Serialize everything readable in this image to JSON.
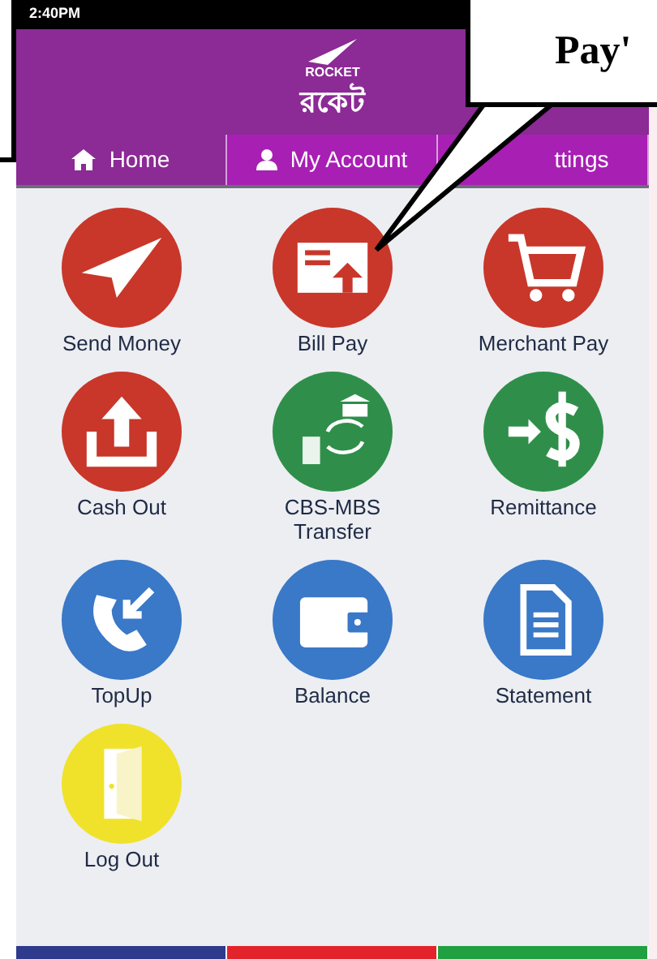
{
  "status_bar": {
    "time": "2:40PM"
  },
  "header": {
    "logo_top": "ROCKET",
    "logo_main": "রকেট"
  },
  "tabs": [
    {
      "label": "Home",
      "selected": true
    },
    {
      "label": "My Account",
      "selected": false
    },
    {
      "label": "ttings",
      "selected": false
    }
  ],
  "services": [
    {
      "label": "Send Money",
      "color": "#c8372a"
    },
    {
      "label": "Bill Pay",
      "color": "#c8372a"
    },
    {
      "label": "Merchant Pay",
      "color": "#c8372a"
    },
    {
      "label": "Cash Out",
      "color": "#c8372a"
    },
    {
      "label": "CBS-MBS Transfer",
      "color": "#2f8f4a"
    },
    {
      "label": "Remittance",
      "color": "#2f8f4a"
    },
    {
      "label": "TopUp",
      "color": "#3a78c8"
    },
    {
      "label": "Balance",
      "color": "#3a78c8"
    },
    {
      "label": "Statement",
      "color": "#3a78c8"
    },
    {
      "label": "Log Out",
      "color": "#f0e22a"
    }
  ],
  "bottom_bar": [
    {
      "color": "#2e3a8c"
    },
    {
      "color": "#e3232b"
    },
    {
      "color": "#20a040"
    }
  ],
  "callout": {
    "text": "Pay'"
  }
}
